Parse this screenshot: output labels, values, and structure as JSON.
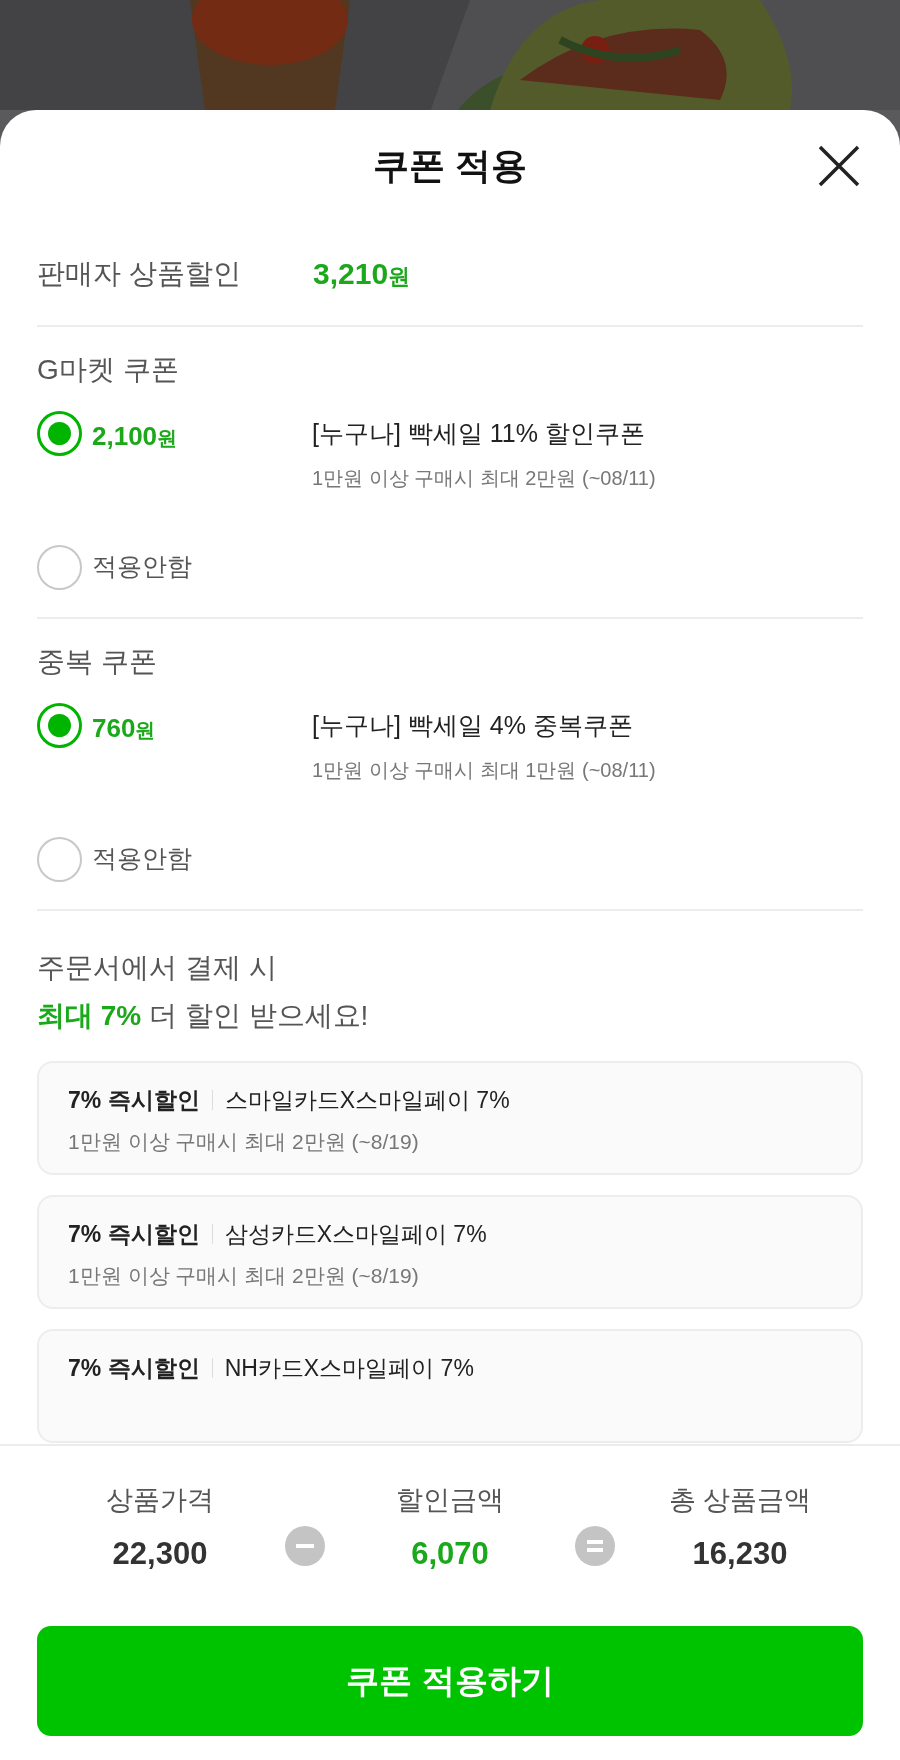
{
  "title": "쿠폰 적용",
  "seller_discount": {
    "label": "판매자 상품할인",
    "amount": "3,210",
    "unit": "원"
  },
  "coupon_groups": [
    {
      "title": "G마켓 쿠폰",
      "options": [
        {
          "kind": "coupon",
          "amount": "2,100",
          "unit": "원",
          "name": "[누구나] 빡세일 11% 할인쿠폰",
          "condition": "1만원 이상 구매시 최대 2만원 (~08/11)",
          "selected": true
        },
        {
          "kind": "none",
          "label": "적용안함",
          "selected": false
        }
      ]
    },
    {
      "title": "중복 쿠폰",
      "options": [
        {
          "kind": "coupon",
          "amount": "760",
          "unit": "원",
          "name": "[누구나] 빡세일 4% 중복쿠폰",
          "condition": "1만원 이상 구매시 최대 1만원 (~08/11)",
          "selected": true
        },
        {
          "kind": "none",
          "label": "적용안함",
          "selected": false
        }
      ]
    }
  ],
  "promo": {
    "line1": "주문서에서 결제 시",
    "highlight": "최대 7%",
    "rest": "더 할인 받으세요!"
  },
  "card_offers": [
    {
      "tag": "7% 즉시할인",
      "name": "스마일카드X스마일페이 7%",
      "condition": "1만원 이상 구매시 최대 2만원 (~8/19)"
    },
    {
      "tag": "7% 즉시할인",
      "name": "삼성카드X스마일페이 7%",
      "condition": "1만원 이상 구매시 최대 2만원 (~8/19)"
    },
    {
      "tag": "7% 즉시할인",
      "name": "NH카드X스마일페이 7%"
    }
  ],
  "summary": [
    {
      "kind": "amount",
      "label": "상품가격",
      "value": "22,300"
    },
    {
      "kind": "minus"
    },
    {
      "kind": "discount",
      "label": "할인금액",
      "value": "6,070"
    },
    {
      "kind": "equals"
    },
    {
      "kind": "amount",
      "label": "총 상품금액",
      "value": "16,230"
    }
  ],
  "apply_button": "쿠폰 적용하기"
}
